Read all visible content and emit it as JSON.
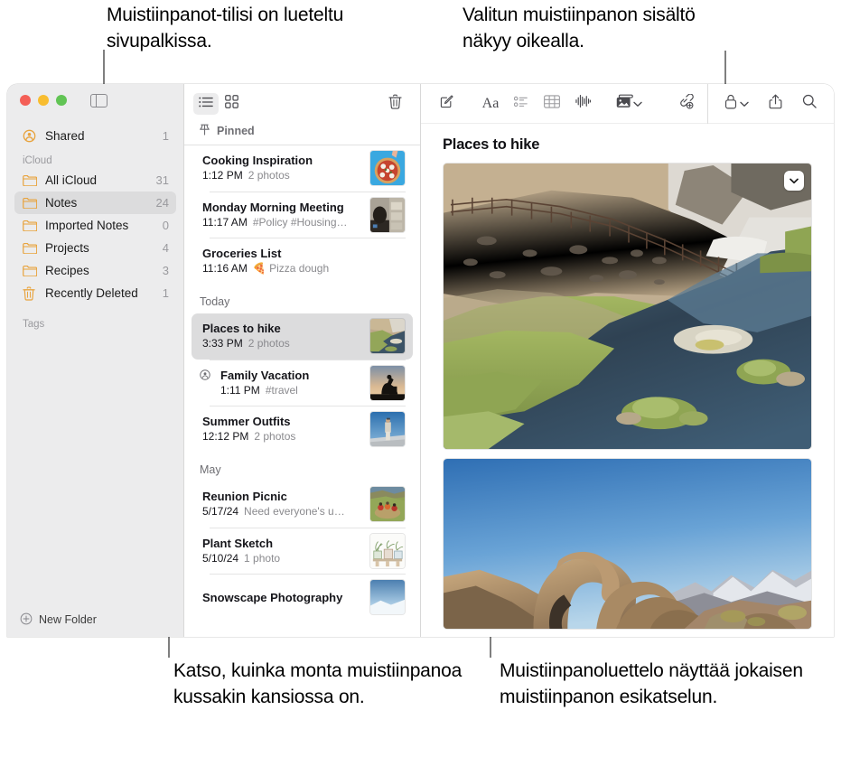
{
  "annotations": {
    "top_left": "Muistiinpanot-tilisi on lueteltu sivupalkissa.",
    "top_right": "Valitun muistiinpanon sisältö näkyy oikealla.",
    "bottom_left": "Katso, kuinka monta muistiinpanoa kussakin kansiossa on.",
    "bottom_right": "Muistiinpanoluettelo näyttää jokaisen muistiinpanon esikatselun."
  },
  "sidebar": {
    "shared": {
      "label": "Shared",
      "count": "1",
      "icon": "shared-person-icon"
    },
    "section_icloud": "iCloud",
    "section_tags": "Tags",
    "items": [
      {
        "label": "All iCloud",
        "count": "31",
        "icon": "folder-icon",
        "selected": false
      },
      {
        "label": "Notes",
        "count": "24",
        "icon": "folder-icon",
        "selected": true
      },
      {
        "label": "Imported Notes",
        "count": "0",
        "icon": "folder-icon",
        "selected": false
      },
      {
        "label": "Projects",
        "count": "4",
        "icon": "folder-icon",
        "selected": false
      },
      {
        "label": "Recipes",
        "count": "3",
        "icon": "folder-icon",
        "selected": false
      },
      {
        "label": "Recently Deleted",
        "count": "1",
        "icon": "trash-icon",
        "selected": false
      }
    ],
    "new_folder": {
      "label": "New Folder",
      "icon": "plus-circle-icon"
    }
  },
  "notes_toolbar": {
    "list_view": "list-view-icon",
    "gallery_view": "gallery-view-icon",
    "delete": "trash-icon"
  },
  "notes_list": {
    "pinned_header": "Pinned",
    "sections": [
      {
        "name": "Pinned",
        "pinned": true,
        "notes": [
          {
            "title": "Cooking Inspiration",
            "date": "1:12 PM",
            "snippet": "2 photos",
            "thumb": "pizza",
            "shared": false,
            "selected": false
          },
          {
            "title": "Monday Morning Meeting",
            "date": "11:17 AM",
            "snippet": "#Policy #Housing…",
            "thumb": "meeting",
            "shared": false,
            "selected": false
          },
          {
            "title": "Groceries List",
            "date": "11:16 AM",
            "snippet": "🍕 Pizza dough",
            "thumb": "",
            "shared": false,
            "selected": false
          }
        ]
      },
      {
        "name": "Today",
        "pinned": false,
        "notes": [
          {
            "title": "Places to hike",
            "date": "3:33 PM",
            "snippet": "2 photos",
            "thumb": "river",
            "shared": false,
            "selected": true
          },
          {
            "title": "Family Vacation",
            "date": "1:11 PM",
            "snippet": "#travel",
            "thumb": "silhouette",
            "shared": true,
            "selected": false
          },
          {
            "title": "Summer Outfits",
            "date": "12:12 PM",
            "snippet": "2 photos",
            "thumb": "outfit",
            "shared": false,
            "selected": false
          }
        ]
      },
      {
        "name": "May",
        "pinned": false,
        "notes": [
          {
            "title": "Reunion Picnic",
            "date": "5/17/24",
            "snippet": "Need everyone's u…",
            "thumb": "picnic",
            "shared": false,
            "selected": false
          },
          {
            "title": "Plant Sketch",
            "date": "5/10/24",
            "snippet": "1 photo",
            "thumb": "plants",
            "shared": false,
            "selected": false
          },
          {
            "title": "Snowscape Photography",
            "date": "",
            "snippet": "",
            "thumb": "snow",
            "shared": false,
            "selected": false
          }
        ]
      }
    ]
  },
  "editor": {
    "toolbar": [
      "compose-icon",
      "format-aa-icon",
      "checklist-icon",
      "table-icon",
      "audio-waveform-icon",
      "media-icon",
      "chevron-down-icon",
      "collaborate-icon",
      "lock-icon",
      "chevron-down-icon",
      "share-icon",
      "search-icon"
    ],
    "note_title": "Places to hike",
    "photo_menu_icon": "chevron-down-icon"
  },
  "colors": {
    "folder_yellow": "#e8a33d",
    "selection_gray": "#dcdcdd",
    "sidebar_bg": "#ececed",
    "text_secondary": "#8a8a8e"
  }
}
